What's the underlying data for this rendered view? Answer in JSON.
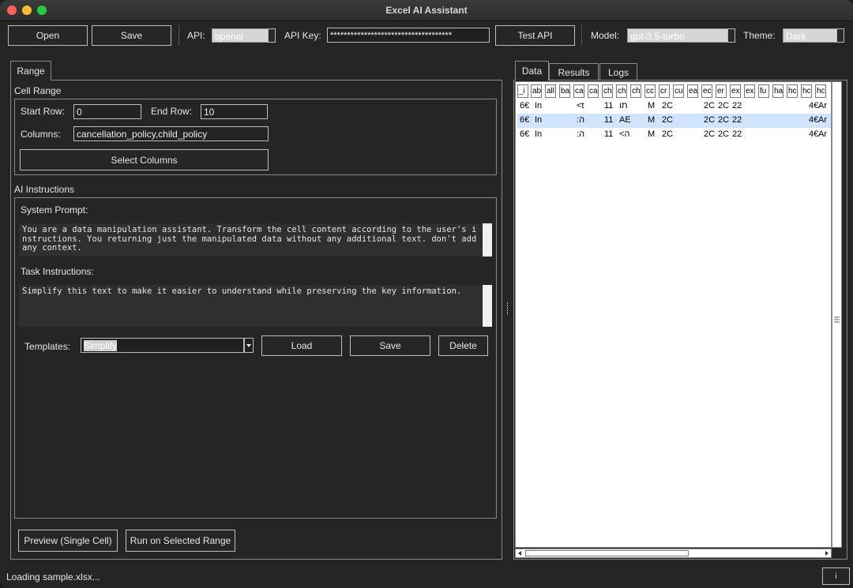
{
  "window": {
    "title": "Excel AI Assistant"
  },
  "toolbar": {
    "open_label": "Open",
    "save_label": "Save",
    "api_label": "API:",
    "api_value": "openai",
    "api_key_label": "API Key:",
    "api_key_value": "************************************",
    "test_api_label": "Test API",
    "model_label": "Model:",
    "model_value": "gpt-3.5-turbo",
    "theme_label": "Theme:",
    "theme_value": "Dark"
  },
  "left_tabs": [
    {
      "label": "Range"
    }
  ],
  "cell_range": {
    "heading": "Cell Range",
    "start_row_label": "Start Row:",
    "start_row_value": "0",
    "end_row_label": "End Row:",
    "end_row_value": "10",
    "columns_label": "Columns:",
    "columns_value": "cancellation_policy,child_policy",
    "select_columns_label": "Select Columns"
  },
  "ai": {
    "heading": "AI Instructions",
    "system_prompt_label": "System Prompt:",
    "system_prompt_text": "You are a data manipulation assistant. Transform the cell content according to the user's instructions. You returning just the manipulated data without any additional text. don't add any context.",
    "task_label": "Task Instructions:",
    "task_text": "Simplify this text to make it easier to understand while preserving the key information.",
    "templates_label": "Templates:",
    "template_value": "Simplify",
    "load_label": "Load",
    "save_label": "Save",
    "delete_label": "Delete"
  },
  "actions": {
    "preview_label": "Preview (Single Cell)",
    "run_label": "Run on Selected Range"
  },
  "right_tabs": [
    {
      "label": "Data"
    },
    {
      "label": "Results"
    },
    {
      "label": "Logs"
    }
  ],
  "grid": {
    "headers": [
      "_i",
      "ab",
      "all",
      "ba",
      "ca",
      "ca",
      "ch",
      "ch",
      "ch",
      "cc",
      "cr",
      "cu",
      "ea",
      "ec",
      "er",
      "ex",
      "ex",
      "fu",
      "ha",
      "hc",
      "hc",
      "hc"
    ],
    "rows": [
      [
        "6€",
        "In",
        "<t",
        "11",
        "תו",
        "M",
        "2C",
        "2C",
        "2C",
        "22",
        "4€",
        "Ar"
      ],
      [
        "6€",
        "In",
        ":ה",
        "11",
        "AE",
        "M",
        "2C",
        "2C",
        "2C",
        "22",
        "4€",
        "Ar"
      ],
      [
        "6€",
        "In",
        ":ה",
        "11",
        "<ה",
        "M",
        "2C",
        "2C",
        "2C",
        "22",
        "4€",
        "Ar"
      ]
    ]
  },
  "status": {
    "text": "Loading sample.xlsx...",
    "info": "i"
  },
  "colors": {
    "accent_selection": "#cfe4ff",
    "window_bg": "#252525"
  }
}
